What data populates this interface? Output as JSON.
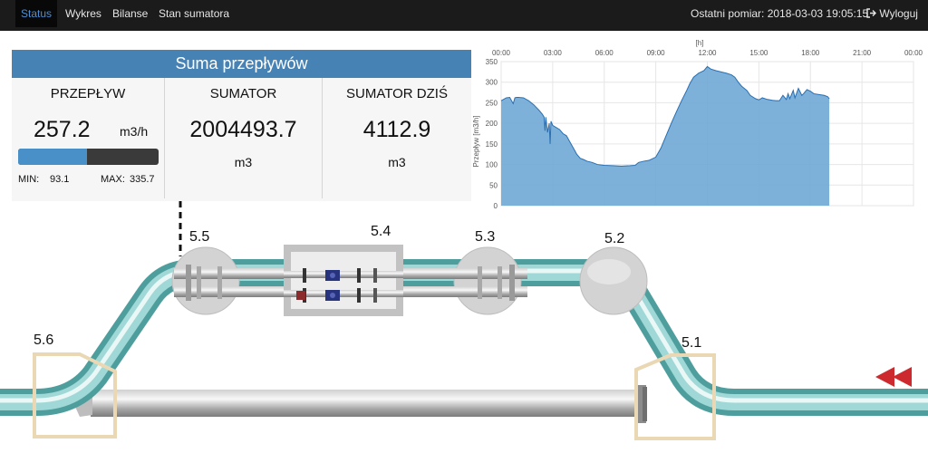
{
  "nav": {
    "items": [
      {
        "label": "Status",
        "active": true
      },
      {
        "label": "Wykres",
        "active": false
      },
      {
        "label": "Bilanse",
        "active": false
      },
      {
        "label": "Stan sumatora",
        "active": false
      }
    ],
    "last_measurement": "Ostatni pomiar: 2018-03-03 19:05:15",
    "logout_label": "Wyloguj",
    "logout_icon": "logout-icon"
  },
  "panel": {
    "title": "Suma przepływów",
    "flow": {
      "header": "PRZEPŁYW",
      "value": "257.2",
      "unit": "m3/h",
      "min_label": "MIN:",
      "min_value": "93.1",
      "max_label": "MAX:",
      "max_value": "335.7",
      "bar_fraction": 0.49
    },
    "total": {
      "header": "SUMATOR",
      "value": "2004493.7",
      "unit": "m3"
    },
    "today": {
      "header": "SUMATOR DZIŚ",
      "value": "4112.9",
      "unit": "m3"
    }
  },
  "chart_data": {
    "type": "area",
    "xlabel": "[h]",
    "ylabel": "Przepływ [m3/h]",
    "x_ticks": [
      "00:00",
      "03:00",
      "06:00",
      "09:00",
      "12:00",
      "15:00",
      "18:00",
      "21:00",
      "00:00"
    ],
    "y_ticks": [
      0,
      50,
      100,
      150,
      200,
      250,
      300,
      350
    ],
    "xlim": [
      0,
      24
    ],
    "ylim": [
      0,
      350
    ],
    "grid": true,
    "x": [
      0,
      0.3,
      0.5,
      0.7,
      0.8,
      0.9,
      1.0,
      1.3,
      1.6,
      1.9,
      2.2,
      2.4,
      2.5,
      2.55,
      2.6,
      2.7,
      2.8,
      2.85,
      2.9,
      3.0,
      3.2,
      3.4,
      3.6,
      3.8,
      4.0,
      4.2,
      4.4,
      4.6,
      4.8,
      5.0,
      5.3,
      5.6,
      6.0,
      6.5,
      7.0,
      7.5,
      7.8,
      8.0,
      8.3,
      8.6,
      9.0,
      9.3,
      9.6,
      9.9,
      10.2,
      10.5,
      10.8,
      11.0,
      11.2,
      11.5,
      11.8,
      12.0,
      12.2,
      12.5,
      12.8,
      13.1,
      13.4,
      13.6,
      13.8,
      14.0,
      14.3,
      14.5,
      14.8,
      15.0,
      15.2,
      15.5,
      15.8,
      16.0,
      16.2,
      16.4,
      16.6,
      16.7,
      16.8,
      17.0,
      17.1,
      17.3,
      17.5,
      17.6,
      17.8,
      18.0,
      18.2,
      18.5,
      18.8,
      19.0,
      19.1
    ],
    "values": [
      255,
      262,
      263,
      248,
      262,
      263,
      263,
      262,
      255,
      245,
      232,
      222,
      215,
      182,
      215,
      178,
      200,
      150,
      205,
      195,
      190,
      185,
      175,
      170,
      155,
      140,
      125,
      115,
      112,
      108,
      105,
      100,
      98,
      97,
      96,
      97,
      98,
      105,
      108,
      110,
      118,
      140,
      170,
      200,
      228,
      255,
      280,
      298,
      312,
      322,
      328,
      338,
      332,
      328,
      325,
      322,
      318,
      312,
      300,
      290,
      280,
      268,
      260,
      257,
      262,
      258,
      256,
      255,
      255,
      268,
      258,
      272,
      260,
      280,
      262,
      285,
      268,
      272,
      282,
      278,
      272,
      270,
      268,
      265,
      260
    ]
  },
  "diagram": {
    "labels": [
      "5.5",
      "5.4",
      "5.3",
      "5.2",
      "5.6",
      "5.1"
    ],
    "pipe_color": "#5fb0b0",
    "box_color": "#ead8b4",
    "direction_arrow_color": "#d6262c"
  }
}
